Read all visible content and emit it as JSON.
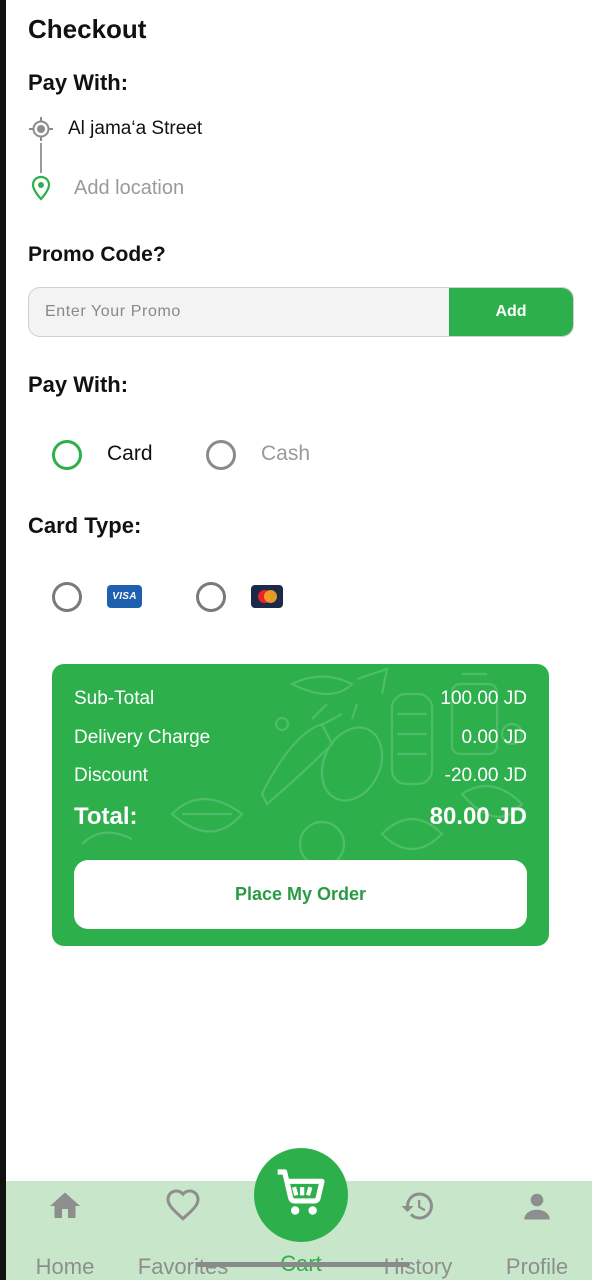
{
  "header": {
    "title": "Checkout"
  },
  "location": {
    "section_title": "Pay With:",
    "current": "Al jama‘a Street",
    "add_label": "Add location"
  },
  "promo": {
    "section_title": "Promo Code?",
    "placeholder": "Enter Your Promo",
    "add_label": "Add"
  },
  "payment": {
    "section_title": "Pay With:",
    "options": [
      {
        "label": "Card",
        "selected": true
      },
      {
        "label": "Cash",
        "selected": false
      }
    ]
  },
  "card_type": {
    "section_title": "Card Type:",
    "options": [
      {
        "brand": "VISA",
        "icon": "visa-icon",
        "selected": false
      },
      {
        "brand": "Mastercard",
        "icon": "mastercard-icon",
        "selected": false
      }
    ]
  },
  "summary": {
    "subtotal_label": "Sub-Total",
    "subtotal_value": "100.00 JD",
    "delivery_label": "Delivery Charge",
    "delivery_value": "0.00 JD",
    "discount_label": "Discount",
    "discount_value": "-20.00 JD",
    "total_label": "Total:",
    "total_value": "80.00 JD",
    "place_order_label": "Place My Order"
  },
  "nav": {
    "items": [
      {
        "label": "Home",
        "icon": "home-icon"
      },
      {
        "label": "Favorites",
        "icon": "heart-icon"
      },
      {
        "label": "Cart",
        "icon": "cart-icon",
        "active": true
      },
      {
        "label": "History",
        "icon": "history-icon"
      },
      {
        "label": "Profile",
        "icon": "person-icon"
      }
    ]
  },
  "colors": {
    "accent": "#2db04c",
    "nav_bg": "#c8e6c9",
    "muted_text": "#9a9a9a"
  }
}
